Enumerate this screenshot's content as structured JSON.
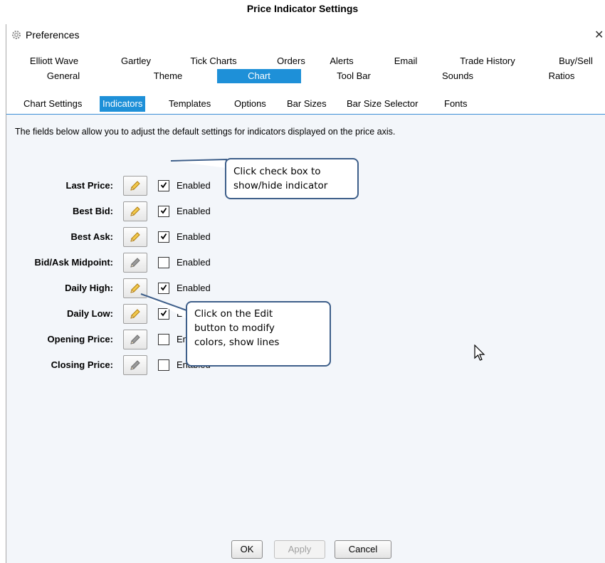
{
  "document": {
    "title": "Price Indicator Settings"
  },
  "window": {
    "title": "Preferences",
    "icons": {
      "app": "gear-icon",
      "close": "close-icon"
    },
    "close_glyph": "✕"
  },
  "tabs_row1": [
    "Elliott Wave",
    "Gartley",
    "Tick Charts",
    "Orders",
    "Alerts",
    "Email",
    "Trade History",
    "Buy/Sell"
  ],
  "tabs_row2": [
    "General",
    "Theme",
    "Chart",
    "Tool Bar",
    "Sounds",
    "Ratios"
  ],
  "selected_tab": "Chart",
  "subtabs": [
    "Chart Settings",
    "Indicators",
    "Templates",
    "Options",
    "Bar Sizes",
    "Bar Size Selector",
    "Fonts"
  ],
  "selected_subtab": "Indicators",
  "description": "The fields below allow you to adjust the default settings for indicators displayed on the price axis.",
  "indicators": [
    {
      "label": "Last Price:",
      "enabled": true,
      "checkbox_label": "Enabled"
    },
    {
      "label": "Best Bid:",
      "enabled": true,
      "checkbox_label": "Enabled"
    },
    {
      "label": "Best Ask:",
      "enabled": true,
      "checkbox_label": "Enabled"
    },
    {
      "label": "Bid/Ask Midpoint:",
      "enabled": false,
      "checkbox_label": "Enabled"
    },
    {
      "label": "Daily High:",
      "enabled": true,
      "checkbox_label": "Enabled"
    },
    {
      "label": "Daily Low:",
      "enabled": true,
      "checkbox_label": "Enabled"
    },
    {
      "label": "Opening Price:",
      "enabled": false,
      "checkbox_label": "Enabled"
    },
    {
      "label": "Closing Price:",
      "enabled": false,
      "checkbox_label": "Enabled"
    }
  ],
  "callouts": {
    "checkbox": {
      "line1": "Click check box to",
      "line2": "show/hide indicator"
    },
    "edit": {
      "line1": "Click on the Edit",
      "line2": "button to modify",
      "line3": "colors, show lines"
    }
  },
  "buttons": {
    "ok": "OK",
    "apply": "Apply",
    "cancel": "Cancel"
  },
  "colors": {
    "accent": "#1e90d8",
    "callout_border": "#3e5f8a",
    "pencil_enabled": "#f2c94c",
    "pencil_disabled": "#9a9a9a"
  }
}
